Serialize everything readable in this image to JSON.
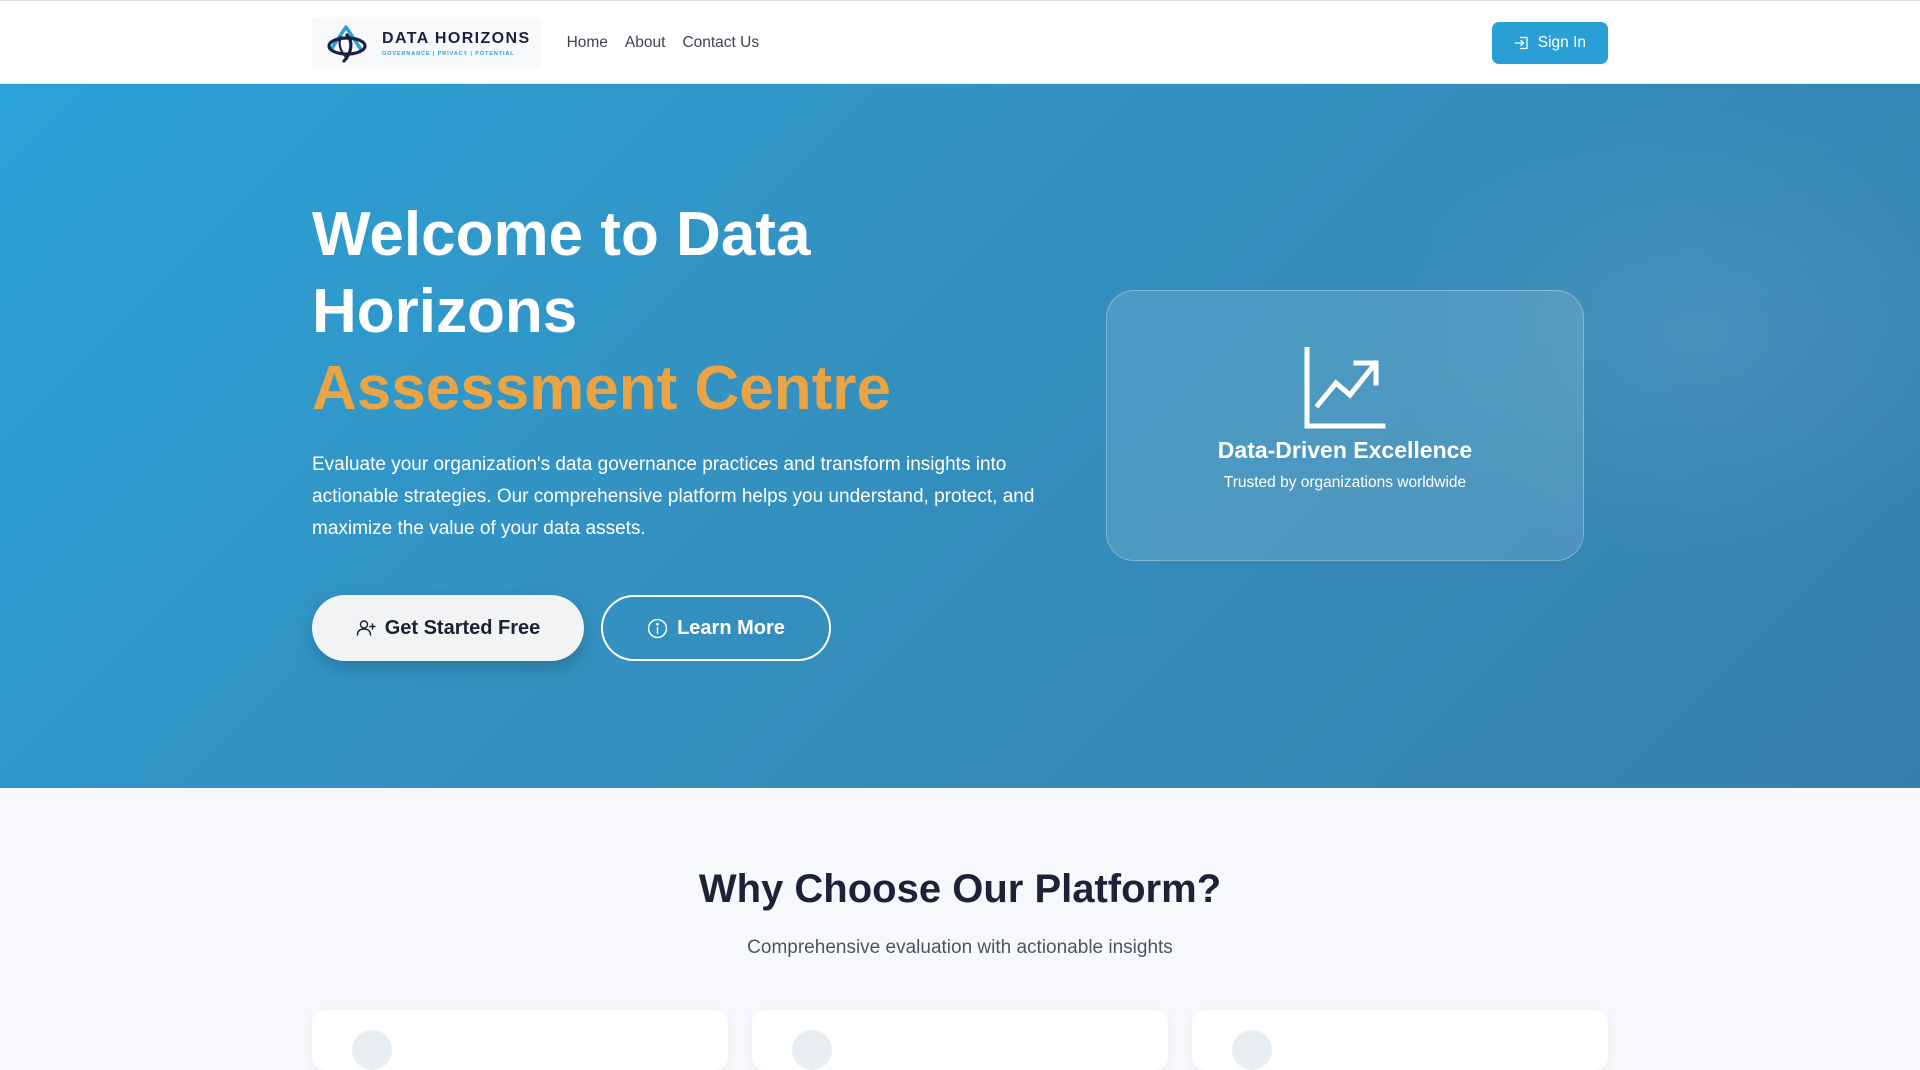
{
  "navbar": {
    "brand_name": "DATA HORIZONS",
    "brand_tagline": "GOVERNANCE | PRIVACY | POTENTIAL",
    "links": [
      {
        "label": "Home"
      },
      {
        "label": "About"
      },
      {
        "label": "Contact Us"
      }
    ],
    "signin_label": "Sign In"
  },
  "hero": {
    "title_line1": "Welcome to Data",
    "title_line2": "Horizons",
    "title_accent": "Assessment Centre",
    "description": "Evaluate your organization's data governance practices and transform insights into actionable strategies. Our comprehensive platform helps you understand, protect, and maximize the value of your data assets.",
    "primary_cta": "Get Started Free",
    "secondary_cta": "Learn More",
    "card_title": "Data-Driven Excellence",
    "card_subtitle": "Trusted by organizations worldwide"
  },
  "why_section": {
    "title": "Why Choose Our Platform?",
    "subtitle": "Comprehensive evaluation with actionable insights"
  },
  "icons": {
    "brand": "data-horizons-logo-icon",
    "signin": "sign-in-icon",
    "primary_cta": "user-plus-icon",
    "secondary_cta": "info-circle-icon",
    "card": "chart-trending-up-icon"
  },
  "colors": {
    "brand_blue": "#2a9fd6",
    "accent_orange": "#eba443",
    "hero_gradient_start": "#2ba2d8",
    "hero_gradient_end": "#367fab",
    "heading_dark": "#1e2238"
  }
}
